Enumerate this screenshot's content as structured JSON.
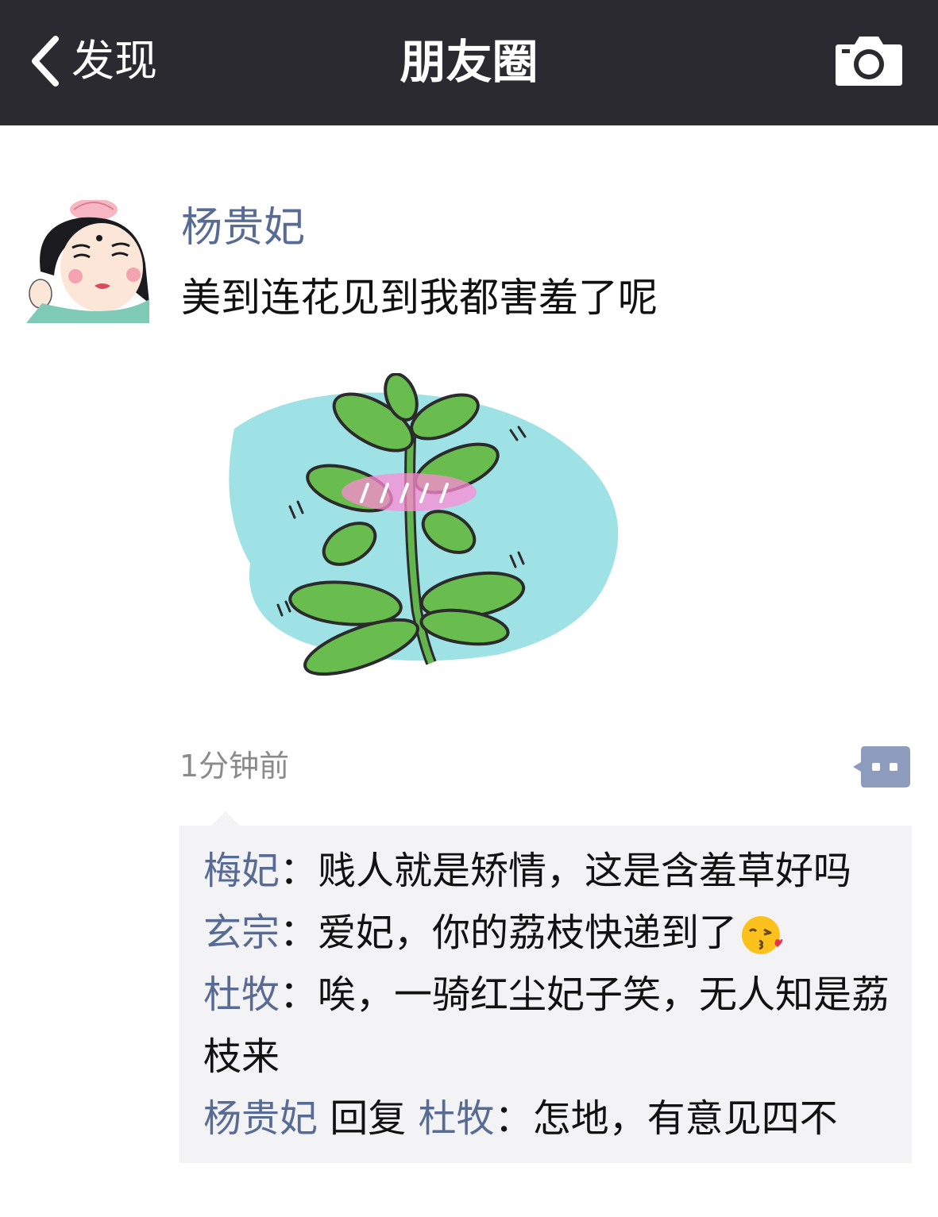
{
  "navbar": {
    "back_label": "发现",
    "title": "朋友圈",
    "camera_icon": "camera-icon"
  },
  "post": {
    "username": "杨贵妃",
    "text": "美到连花见到我都害羞了呢",
    "timestamp": "1分钟前",
    "image": "mimosa-plant-illustration"
  },
  "comments": [
    {
      "name": "梅妃",
      "sep": "：",
      "text": "贱人就是矫情，这是含羞草好吗"
    },
    {
      "name": "玄宗",
      "sep": "：",
      "text": "爱妃，你的荔枝快递到了",
      "emoji": "kiss-emoji"
    },
    {
      "name": "杜牧",
      "sep": "：",
      "text": "唉，一骑红尘妃子笑，无人知是荔枝来"
    },
    {
      "name": "杨贵妃",
      "reply_word": " 回复 ",
      "reply_to": "杜牧",
      "sep": "：",
      "text": "怎地，有意见四不"
    }
  ],
  "colors": {
    "navbar_bg": "#2b2a30",
    "link_blue": "#576b95",
    "comment_bg": "#f3f3f5"
  }
}
